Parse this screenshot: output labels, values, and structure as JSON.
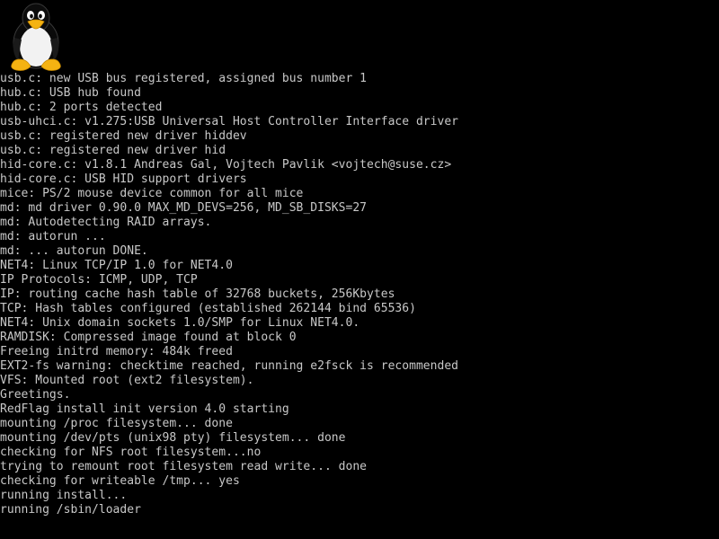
{
  "logo": {
    "name": "tux-penguin-logo"
  },
  "colors": {
    "background": "#000000",
    "text": "#c8c8c8"
  },
  "console_lines": [
    "usb.c: new USB bus registered, assigned bus number 1",
    "hub.c: USB hub found",
    "hub.c: 2 ports detected",
    "usb-uhci.c: v1.275:USB Universal Host Controller Interface driver",
    "usb.c: registered new driver hiddev",
    "usb.c: registered new driver hid",
    "hid-core.c: v1.8.1 Andreas Gal, Vojtech Pavlik <vojtech@suse.cz>",
    "hid-core.c: USB HID support drivers",
    "mice: PS/2 mouse device common for all mice",
    "md: md driver 0.90.0 MAX_MD_DEVS=256, MD_SB_DISKS=27",
    "md: Autodetecting RAID arrays.",
    "md: autorun ...",
    "md: ... autorun DONE.",
    "NET4: Linux TCP/IP 1.0 for NET4.0",
    "IP Protocols: ICMP, UDP, TCP",
    "IP: routing cache hash table of 32768 buckets, 256Kbytes",
    "TCP: Hash tables configured (established 262144 bind 65536)",
    "NET4: Unix domain sockets 1.0/SMP for Linux NET4.0.",
    "RAMDISK: Compressed image found at block 0",
    "Freeing initrd memory: 484k freed",
    "EXT2-fs warning: checktime reached, running e2fsck is recommended",
    "VFS: Mounted root (ext2 filesystem).",
    "Greetings.",
    "RedFlag install init version 4.0 starting",
    "mounting /proc filesystem... done",
    "mounting /dev/pts (unix98 pty) filesystem... done",
    "checking for NFS root filesystem...no",
    "trying to remount root filesystem read write... done",
    "checking for writeable /tmp... yes",
    "running install...",
    "running /sbin/loader"
  ]
}
